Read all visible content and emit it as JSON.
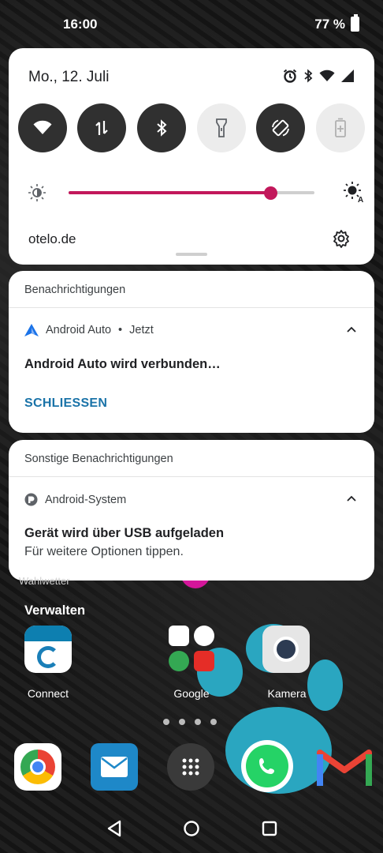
{
  "status_bar": {
    "time": "16:00",
    "battery": "77 %"
  },
  "quick_settings": {
    "date": "Mo., 12. Juli",
    "carrier": "otelo.de",
    "brightness_level": 0.82,
    "tiles": [
      {
        "name": "wifi",
        "active": true
      },
      {
        "name": "mobile-data",
        "active": true
      },
      {
        "name": "bluetooth",
        "active": true
      },
      {
        "name": "flashlight",
        "active": false
      },
      {
        "name": "auto-rotate",
        "active": true
      },
      {
        "name": "battery-saver",
        "active": false
      }
    ]
  },
  "notifications_group": {
    "header": "Benachrichtigungen",
    "app": "Android Auto",
    "time": "Jetzt",
    "title": "Android Auto wird verbunden…",
    "action": "SCHLIESSEN"
  },
  "other_group": {
    "header": "Sonstige Benachrichtigungen",
    "app": "Android-System",
    "title": "Gerät wird über USB aufgeladen",
    "text": "Für weitere Optionen tippen."
  },
  "home": {
    "manage": "Verwalten",
    "partial_label": "Wahlwetter",
    "apps": [
      "Connect",
      "Google",
      "Kamera"
    ]
  },
  "colors": {
    "accent": "#c2185b",
    "action": "#1a73a8"
  }
}
